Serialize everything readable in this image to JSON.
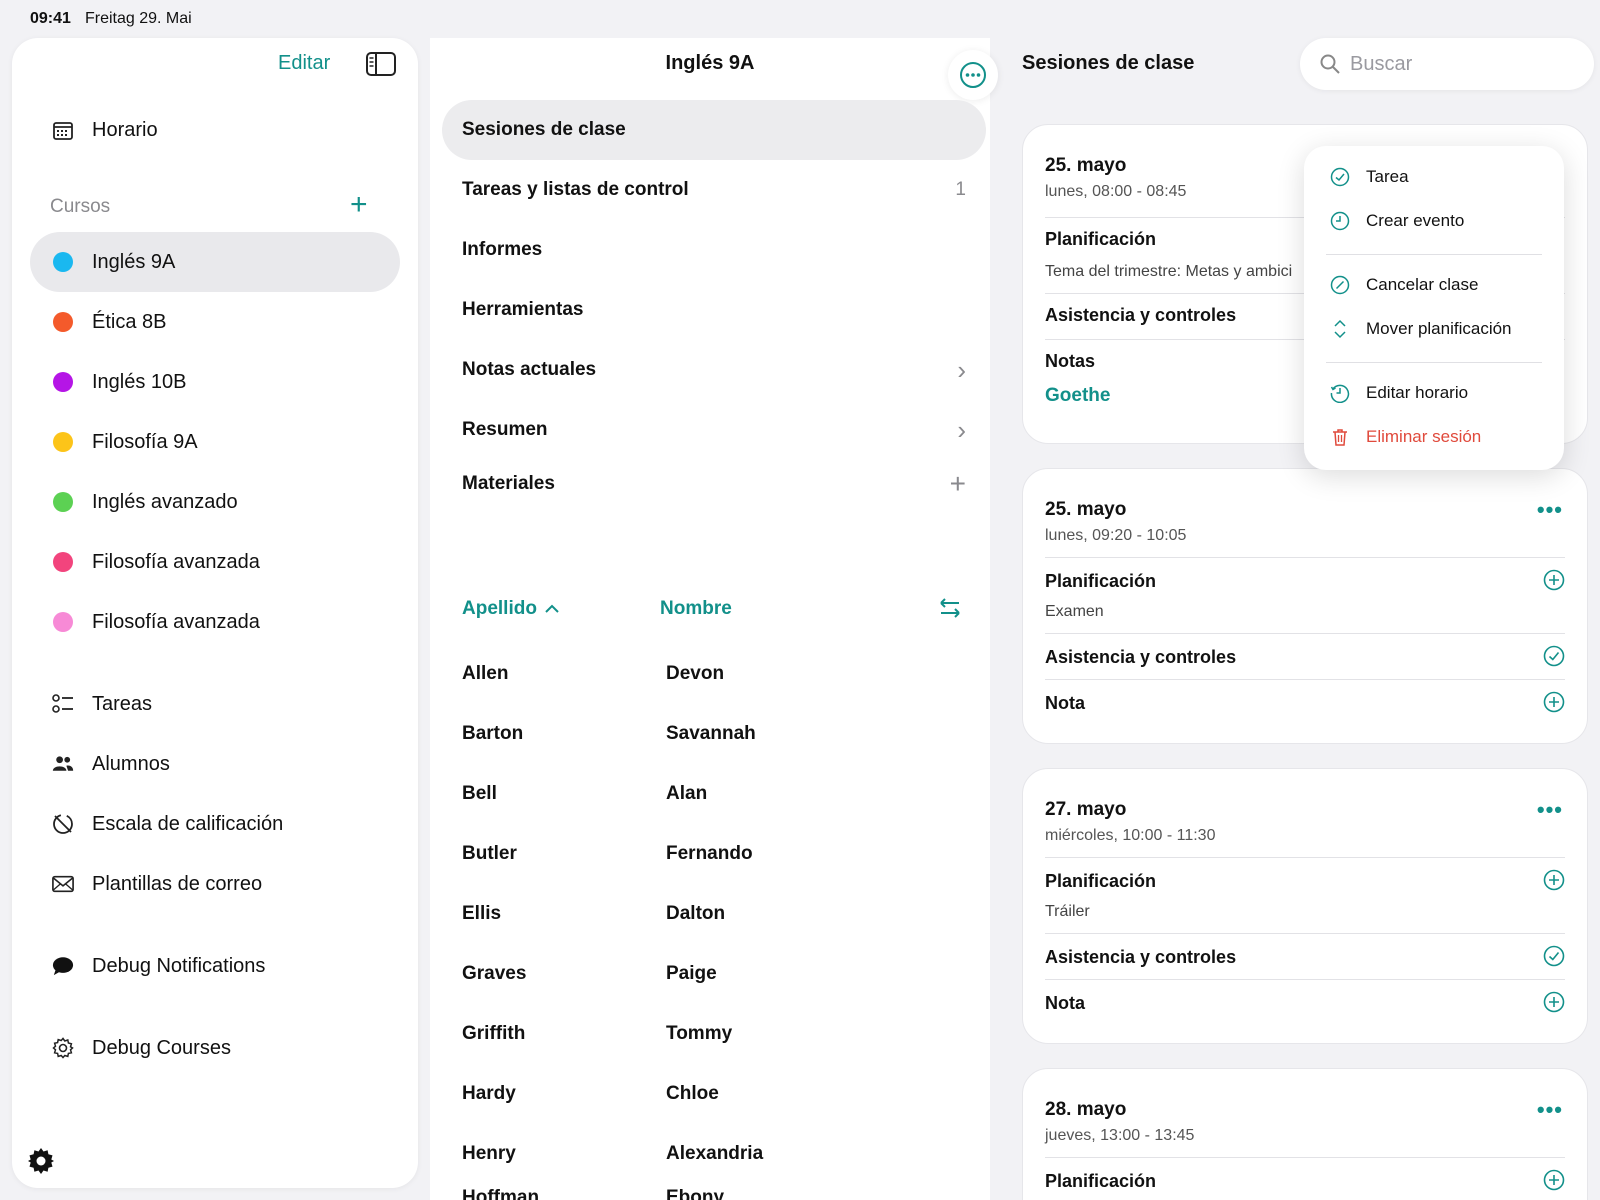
{
  "status": {
    "time": "09:41",
    "date": "Freitag 29. Mai"
  },
  "sidebar": {
    "edit_label": "Editar",
    "schedule_label": "Horario",
    "courses_label": "Cursos",
    "courses": [
      {
        "label": "Inglés 9A",
        "color": "#1ab8f0"
      },
      {
        "label": "Ética 8B",
        "color": "#f45a2b"
      },
      {
        "label": "Inglés 10B",
        "color": "#b515e6"
      },
      {
        "label": "Filosofía 9A",
        "color": "#fcc419"
      },
      {
        "label": "Inglés avanzado",
        "color": "#5cd153"
      },
      {
        "label": "Filosofía avanzada",
        "color": "#f2447d"
      },
      {
        "label": "Filosofía avanzada",
        "color": "#f78ad6"
      }
    ],
    "tools": [
      {
        "label": "Tareas",
        "icon": "task-list-icon"
      },
      {
        "label": "Alumnos",
        "icon": "people-icon"
      },
      {
        "label": "Escala de calificación",
        "icon": "grading-scale-icon"
      },
      {
        "label": "Plantillas de correo",
        "icon": "envelope-icon"
      }
    ],
    "debug_notifications": "Debug Notifications",
    "debug_courses": "Debug Courses"
  },
  "middle": {
    "title": "Inglés 9A",
    "menu": [
      {
        "label": "Sesiones de clase",
        "trail": ""
      },
      {
        "label": "Tareas y listas de control",
        "trail": "1"
      },
      {
        "label": "Informes",
        "trail": ""
      },
      {
        "label": "Herramientas",
        "trail": ""
      },
      {
        "label": "Notas actuales",
        "trail": "›"
      },
      {
        "label": "Resumen",
        "trail": "›"
      },
      {
        "label": "Materiales",
        "trail": "+"
      }
    ],
    "col_lastname": "Apellido",
    "col_firstname": "Nombre",
    "students": [
      {
        "last": "Allen",
        "first": "Devon"
      },
      {
        "last": "Barton",
        "first": "Savannah"
      },
      {
        "last": "Bell",
        "first": "Alan"
      },
      {
        "last": "Butler",
        "first": "Fernando"
      },
      {
        "last": "Ellis",
        "first": "Dalton"
      },
      {
        "last": "Graves",
        "first": "Paige"
      },
      {
        "last": "Griffith",
        "first": "Tommy"
      },
      {
        "last": "Hardy",
        "first": "Chloe"
      },
      {
        "last": "Henry",
        "first": "Alexandria"
      },
      {
        "last": "Hoffman",
        "first": "Ebony"
      }
    ]
  },
  "right": {
    "title": "Sesiones de clase",
    "search_placeholder": "Buscar",
    "sessions": [
      {
        "date": "25. mayo",
        "time": "lunes, 08:00 - 08:45",
        "planning_label": "Planificación",
        "planning_text": "Tema del trimestre: Metas y ambici",
        "attendance_label": "Asistencia y controles",
        "notes_label": "Notas",
        "notes_link": "Goethe"
      },
      {
        "date": "25. mayo",
        "time": "lunes, 09:20 - 10:05",
        "planning_label": "Planificación",
        "planning_text": "Examen",
        "attendance_label": "Asistencia y controles",
        "notes_label": "Nota"
      },
      {
        "date": "27. mayo",
        "time": "miércoles, 10:00 - 11:30",
        "planning_label": "Planificación",
        "planning_text": "Tráiler",
        "attendance_label": "Asistencia y controles",
        "notes_label": "Nota"
      },
      {
        "date": "28. mayo",
        "time": "jueves, 13:00 - 13:45",
        "planning_label": "Planificación"
      }
    ],
    "more_glyph": "•••"
  },
  "context_menu": {
    "items": [
      {
        "label": "Tarea",
        "icon": "check-circle-icon"
      },
      {
        "label": "Crear evento",
        "icon": "clock-icon"
      },
      {
        "label": "Cancelar clase",
        "icon": "cancel-circle-icon"
      },
      {
        "label": "Mover planificación",
        "icon": "move-arrows-icon"
      },
      {
        "label": "Editar horario",
        "icon": "clock-edit-icon"
      },
      {
        "label": "Eliminar sesión",
        "icon": "trash-icon"
      }
    ]
  },
  "colors": {
    "accent": "#12908a",
    "danger": "#e04a3c"
  }
}
